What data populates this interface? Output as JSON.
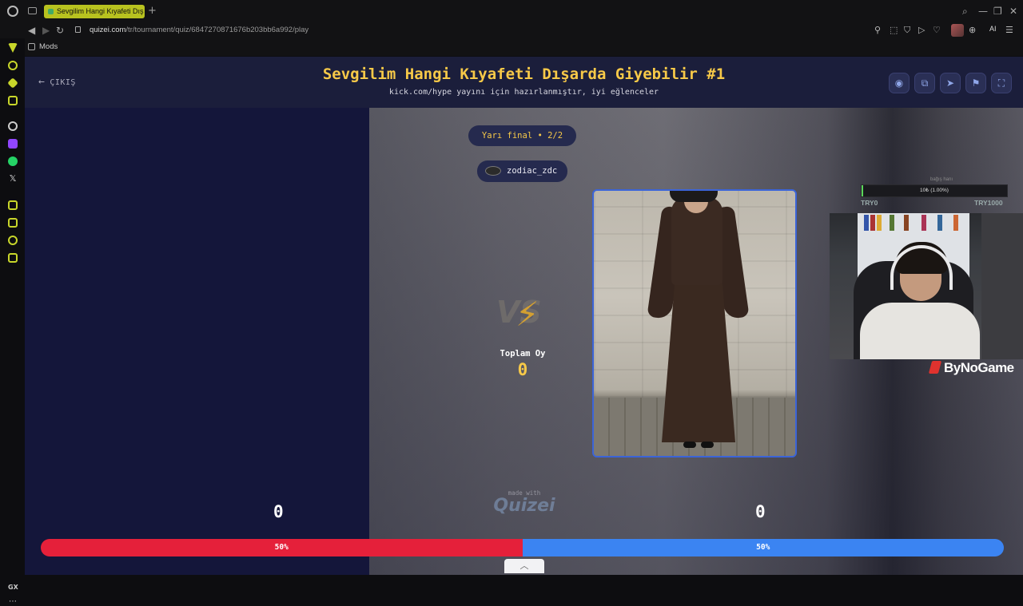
{
  "browser": {
    "tab_title": "Sevgilim Hangi Kıyafeti Dış",
    "url_host": "quizei.com",
    "url_path": "/tr/tournament/quiz/6847270871676b203bb6a992/play",
    "bookmark_label": "Mods",
    "ai_label": "AI",
    "sidebar_bottom_label": "GX"
  },
  "header": {
    "exit_label": "ÇIKIŞ",
    "title": "Sevgilim Hangi Kıyafeti Dışarda Giyebilir #1",
    "subtitle": "kick.com/hype yayını için hazırlanmıştır, iyi eğlenceler"
  },
  "round": {
    "stage_label": "Yarı final • 2/2",
    "creator": "zodiac_zdc",
    "vs_label": "VS",
    "total_votes_label": "Toplam Oy",
    "total_votes_value": "0"
  },
  "scores": {
    "left": "0",
    "right": "0",
    "left_percent_label": "50%",
    "right_percent_label": "50%",
    "left_fraction": 0.5,
    "right_fraction": 0.5
  },
  "overlay": {
    "donate_name": "bağış hanı",
    "donate_progress_text": "10₺ (1.00%)",
    "donate_progress_fraction": 0.01,
    "donate_min": "TRY0",
    "donate_max": "TRY1000",
    "brand": "ByNoGame"
  },
  "footer": {
    "made_with": "made with",
    "made_logo": "Quizei"
  },
  "colors": {
    "accent_yellow": "#f7c948",
    "left_bar": "#e5203a",
    "right_bar": "#3b84f2",
    "card_border": "#3b64d8"
  }
}
